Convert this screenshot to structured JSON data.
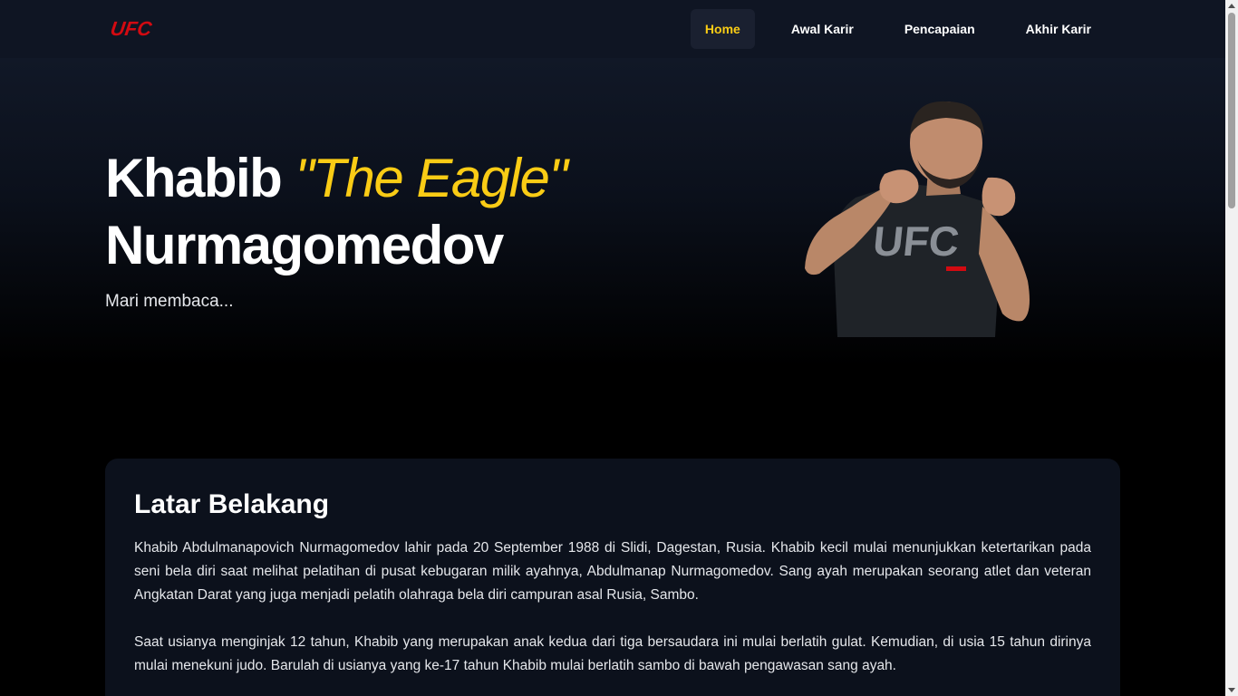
{
  "nav": {
    "logo": "UFC",
    "links": [
      "Home",
      "Awal Karir",
      "Pencapaian",
      "Akhir Karir"
    ],
    "active": "Home"
  },
  "hero": {
    "title_first": "Khabib ",
    "title_nick": "\"The Eagle\"",
    "title_last": "Nurmagomedov",
    "subtitle": "Mari membaca...",
    "image_alt": "fighter-photo",
    "shirt_text": "UFC"
  },
  "section": {
    "title": "Latar Belakang",
    "paragraphs": [
      "Khabib Abdulmanapovich Nurmagomedov lahir pada 20 September 1988 di Slidi, Dagestan, Rusia. Khabib kecil mulai menunjukkan ketertarikan pada seni bela diri saat melihat pelatihan di pusat kebugaran milik ayahnya, Abdulmanap Nurmagomedov. Sang ayah merupakan seorang atlet dan veteran Angkatan Darat yang juga menjadi pelatih olahraga bela diri campuran asal Rusia, Sambo.",
      "Saat usianya menginjak 12 tahun, Khabib yang merupakan anak kedua dari tiga bersaudara ini mulai berlatih gulat. Kemudian, di usia 15 tahun dirinya mulai menekuni judo. Barulah di usianya yang ke-17 tahun Khabib mulai berlatih sambo di bawah pengawasan sang ayah."
    ]
  },
  "colors": {
    "accent": "#facc15",
    "brand": "#d20a11",
    "nav_bg": "#0f1523",
    "card_bg": "#0c111c"
  }
}
